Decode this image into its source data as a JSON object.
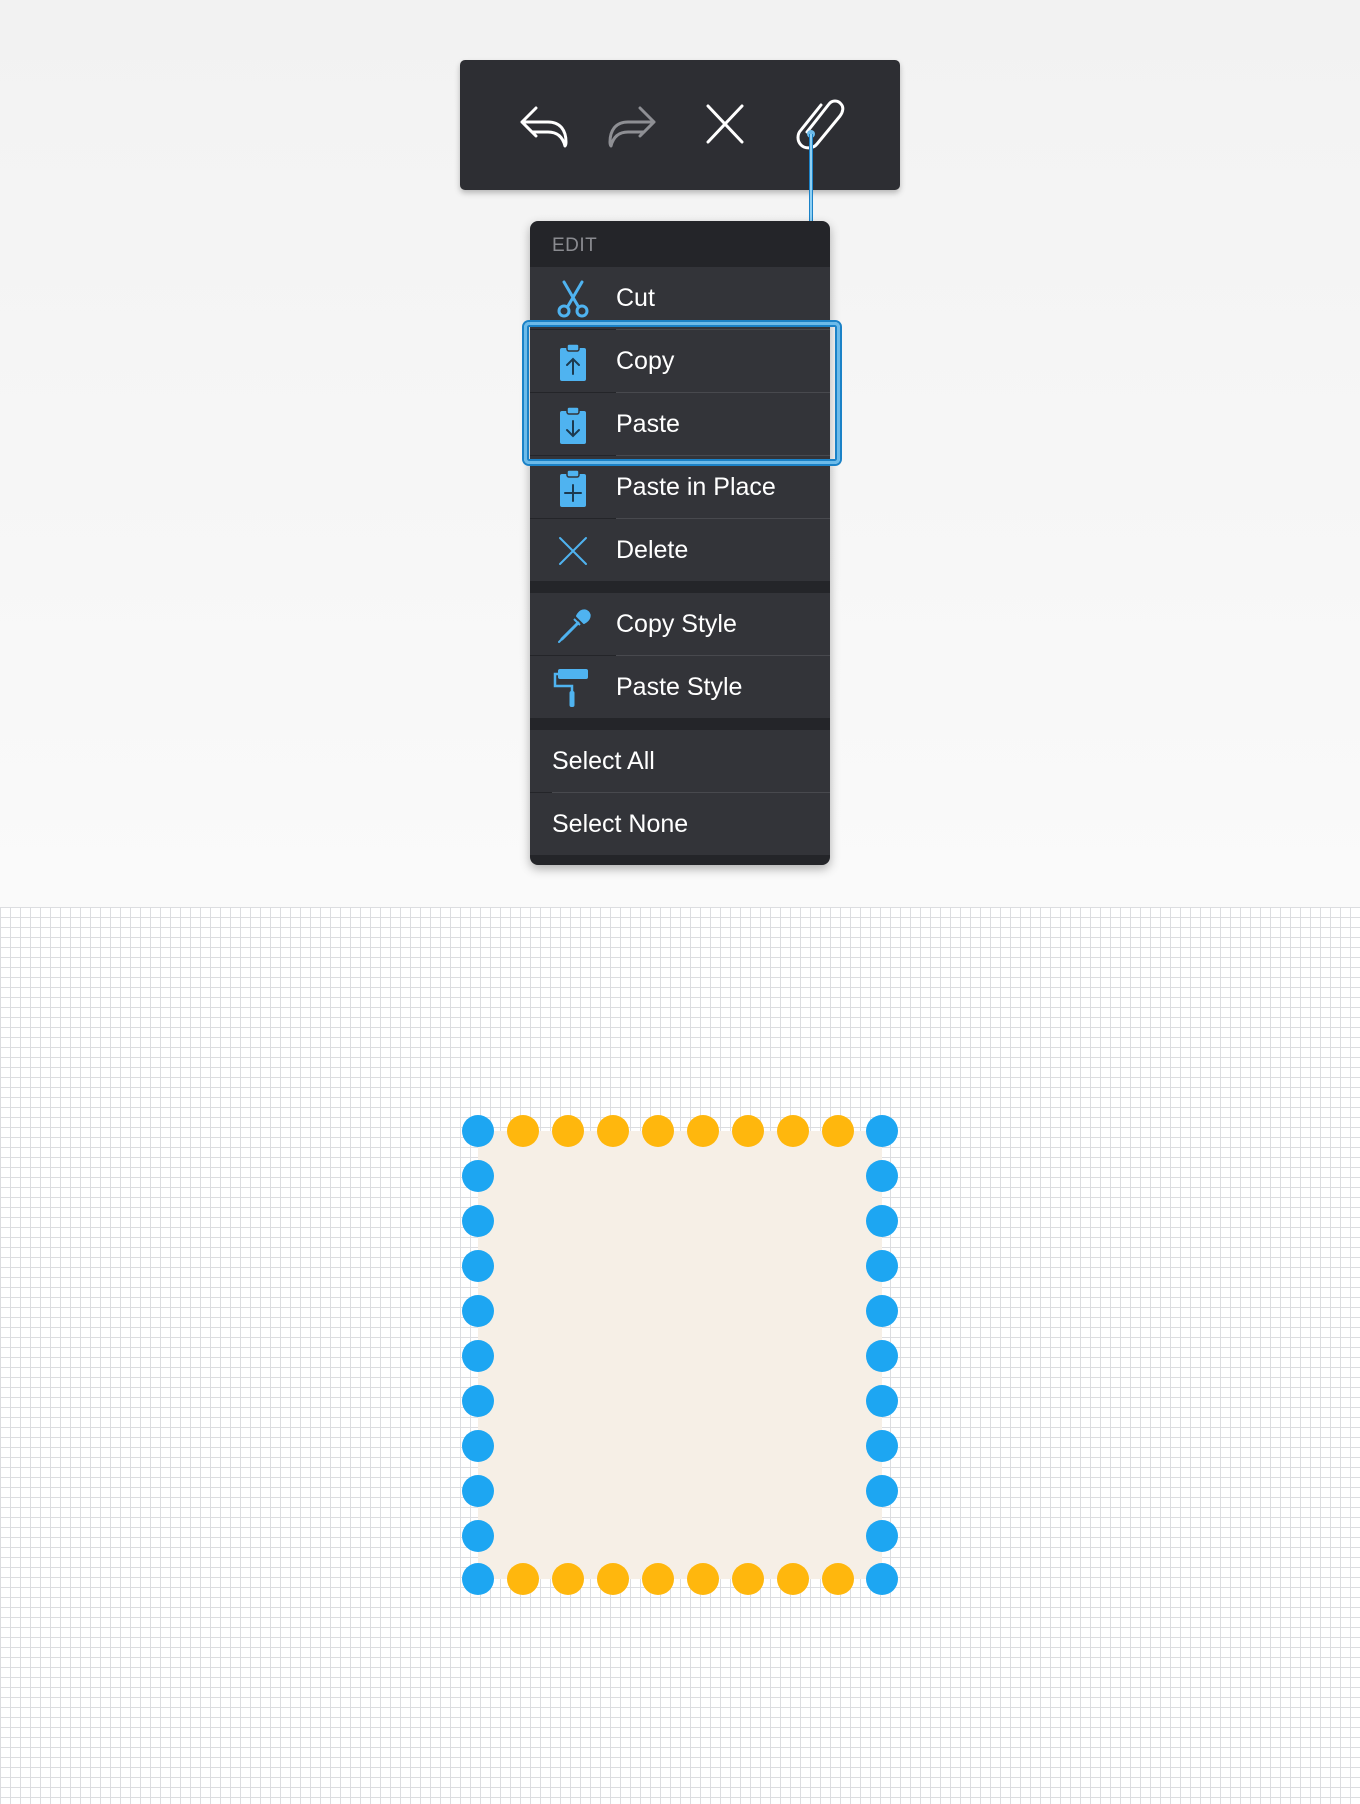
{
  "toolbar": {
    "buttons": [
      {
        "name": "undo",
        "icon": "undo-arrow-icon"
      },
      {
        "name": "redo",
        "icon": "redo-arrow-icon"
      },
      {
        "name": "close",
        "icon": "close-x-icon"
      },
      {
        "name": "edit",
        "icon": "paperclip-icon"
      }
    ]
  },
  "menu": {
    "header": "EDIT",
    "items": [
      {
        "label": "Cut",
        "icon": "scissors-icon"
      },
      {
        "label": "Copy",
        "icon": "clipboard-up-arrow-icon"
      },
      {
        "label": "Paste",
        "icon": "clipboard-down-arrow-icon"
      },
      {
        "label": "Paste in Place",
        "icon": "clipboard-plus-icon"
      },
      {
        "label": "Delete",
        "icon": "x-icon"
      },
      {
        "label": "Copy Style",
        "icon": "eyedropper-icon"
      },
      {
        "label": "Paste Style",
        "icon": "paint-roller-icon"
      },
      {
        "label": "Select All"
      },
      {
        "label": "Select None"
      }
    ],
    "highlighted": [
      "Copy",
      "Paste"
    ]
  },
  "colors": {
    "accent": "#1da6f2",
    "anchor_point": "#1da6f2",
    "midpoint": "#ffb70d",
    "shape_fill": "#f6efe6",
    "menu_background": "#333439",
    "toolbar_background": "#2d2e33"
  }
}
